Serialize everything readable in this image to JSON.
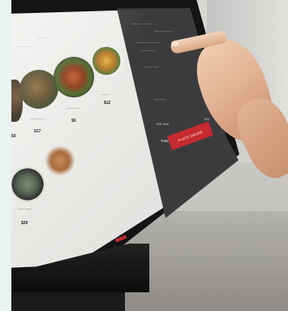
{
  "photo": {
    "description_icons": [
      "finger-pointer"
    ]
  },
  "kiosk_screen": {
    "menu_tabs": [
      "",
      ""
    ],
    "menu_items": [
      {
        "name": "",
        "price": "$9"
      },
      {
        "name": "",
        "price": "$17"
      },
      {
        "name": "",
        "price": "$6"
      },
      {
        "name": "",
        "price": "$12"
      },
      {
        "name": "",
        "price": "$20"
      },
      {
        "name": "",
        "price": ""
      }
    ],
    "order_panel": {
      "subtotal_label": "Sub Total",
      "subtotal_value": "$23",
      "total_label": "Total",
      "total_value": "$23",
      "button_label": "PLACE ORDER"
    }
  },
  "colors": {
    "accent_red": "#c62a2f",
    "panel_dark": "#3b3b3d",
    "bezel": "#141414",
    "background_wall": "#cfcfcc"
  }
}
